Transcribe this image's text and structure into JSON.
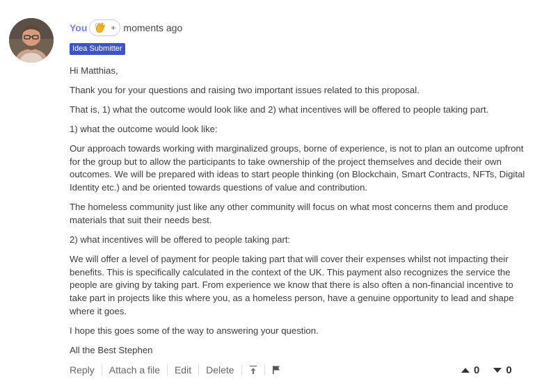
{
  "comment": {
    "author": "You",
    "reaction_plus": "+",
    "timestamp": "moments ago",
    "badge": "Idea Submitter",
    "paragraphs": [
      "Hi Matthias,",
      "Thank you for your questions and raising two important issues related to this proposal.",
      "That is, 1) what the outcome would look like and 2) what incentives will be offered to people taking part.",
      "1) what the outcome would look like:",
      "Our approach towards working with marginalized groups, borne of experience, is not to plan an outcome upfront for the group but to allow the participants to take ownership of the project themselves and decide their own outcomes. We will be prepared with ideas to start people thinking (on Blockchain, Smart Contracts, NFTs, Digital Identity etc.) and be oriented towards questions of value and contribution.",
      "The homeless community just like any other community will focus on what most concerns them and produce materials that suit their needs best.",
      "2) what incentives will be offered to people taking part:",
      "We will offer a level of payment for people taking part that will cover their expenses whilst not impacting their benefits. This is specifically calculated in the context of the UK. This payment also recognizes the service the people are giving by taking part. From experience we know that there is also often a non-financial incentive to take part in projects like this where you, as a homeless person, have a genuine opportunity to lead and shape where it goes.",
      "I hope this goes some of the way to answering your question.",
      "All the Best Stephen"
    ]
  },
  "actions": {
    "reply": "Reply",
    "attach": "Attach a file",
    "edit": "Edit",
    "delete": "Delete"
  },
  "votes": {
    "up": "0",
    "down": "0"
  },
  "icons": {
    "reaction": "clapping-hands-icon",
    "pin": "pin-to-top-icon",
    "flag": "flag-icon",
    "upvote": "upvote-triangle-icon",
    "downvote": "downvote-triangle-icon"
  }
}
